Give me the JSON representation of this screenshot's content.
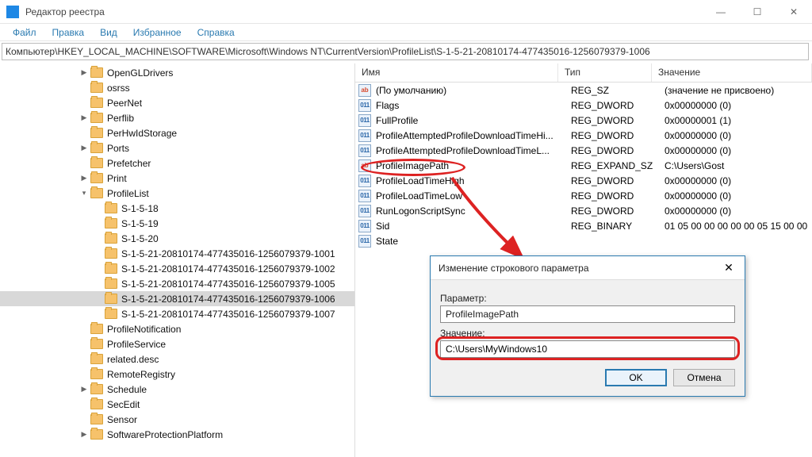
{
  "titlebar": {
    "title": "Редактор реестра"
  },
  "menu": {
    "file": "Файл",
    "edit": "Правка",
    "view": "Вид",
    "favorites": "Избранное",
    "help": "Справка"
  },
  "address": "Компьютер\\HKEY_LOCAL_MACHINE\\SOFTWARE\\Microsoft\\Windows NT\\CurrentVersion\\ProfileList\\S-1-5-21-20810174-477435016-1256079379-1006",
  "tree": [
    {
      "indent": 5,
      "tw": "▶",
      "label": "OpenGLDrivers"
    },
    {
      "indent": 5,
      "tw": "",
      "label": "osrss"
    },
    {
      "indent": 5,
      "tw": "",
      "label": "PeerNet"
    },
    {
      "indent": 5,
      "tw": "▶",
      "label": "Perflib"
    },
    {
      "indent": 5,
      "tw": "",
      "label": "PerHwIdStorage"
    },
    {
      "indent": 5,
      "tw": "▶",
      "label": "Ports"
    },
    {
      "indent": 5,
      "tw": "",
      "label": "Prefetcher"
    },
    {
      "indent": 5,
      "tw": "▶",
      "label": "Print"
    },
    {
      "indent": 5,
      "tw": "▾",
      "label": "ProfileList"
    },
    {
      "indent": 6,
      "tw": "",
      "label": "S-1-5-18"
    },
    {
      "indent": 6,
      "tw": "",
      "label": "S-1-5-19"
    },
    {
      "indent": 6,
      "tw": "",
      "label": "S-1-5-20"
    },
    {
      "indent": 6,
      "tw": "",
      "label": "S-1-5-21-20810174-477435016-1256079379-1001"
    },
    {
      "indent": 6,
      "tw": "",
      "label": "S-1-5-21-20810174-477435016-1256079379-1002"
    },
    {
      "indent": 6,
      "tw": "",
      "label": "S-1-5-21-20810174-477435016-1256079379-1005"
    },
    {
      "indent": 6,
      "tw": "",
      "label": "S-1-5-21-20810174-477435016-1256079379-1006",
      "selected": true
    },
    {
      "indent": 6,
      "tw": "",
      "label": "S-1-5-21-20810174-477435016-1256079379-1007"
    },
    {
      "indent": 5,
      "tw": "",
      "label": "ProfileNotification"
    },
    {
      "indent": 5,
      "tw": "",
      "label": "ProfileService"
    },
    {
      "indent": 5,
      "tw": "",
      "label": "related.desc"
    },
    {
      "indent": 5,
      "tw": "",
      "label": "RemoteRegistry"
    },
    {
      "indent": 5,
      "tw": "▶",
      "label": "Schedule"
    },
    {
      "indent": 5,
      "tw": "",
      "label": "SecEdit"
    },
    {
      "indent": 5,
      "tw": "",
      "label": "Sensor"
    },
    {
      "indent": 5,
      "tw": "▶",
      "label": "SoftwareProtectionPlatform"
    }
  ],
  "list": {
    "headers": {
      "name": "Имя",
      "type": "Тип",
      "value": "Значение"
    },
    "rows": [
      {
        "icon": "ab",
        "name": "(По умолчанию)",
        "type": "REG_SZ",
        "value": "(значение не присвоено)"
      },
      {
        "icon": "bin",
        "name": "Flags",
        "type": "REG_DWORD",
        "value": "0x00000000 (0)"
      },
      {
        "icon": "bin",
        "name": "FullProfile",
        "type": "REG_DWORD",
        "value": "0x00000001 (1)"
      },
      {
        "icon": "bin",
        "name": "ProfileAttemptedProfileDownloadTimeHi...",
        "type": "REG_DWORD",
        "value": "0x00000000 (0)"
      },
      {
        "icon": "bin",
        "name": "ProfileAttemptedProfileDownloadTimeL...",
        "type": "REG_DWORD",
        "value": "0x00000000 (0)"
      },
      {
        "icon": "ab",
        "name": "ProfileImagePath",
        "type": "REG_EXPAND_SZ",
        "value": "C:\\Users\\Gost"
      },
      {
        "icon": "bin",
        "name": "ProfileLoadTimeHigh",
        "type": "REG_DWORD",
        "value": "0x00000000 (0)"
      },
      {
        "icon": "bin",
        "name": "ProfileLoadTimeLow",
        "type": "REG_DWORD",
        "value": "0x00000000 (0)"
      },
      {
        "icon": "bin",
        "name": "RunLogonScriptSync",
        "type": "REG_DWORD",
        "value": "0x00000000 (0)"
      },
      {
        "icon": "bin",
        "name": "Sid",
        "type": "REG_BINARY",
        "value": "01 05 00 00 00 00 00 05 15 00 00"
      },
      {
        "icon": "bin",
        "name": "State",
        "type": "",
        "value": ""
      }
    ]
  },
  "dialog": {
    "title": "Изменение строкового параметра",
    "param_label": "Параметр:",
    "param_value": "ProfileImagePath",
    "value_label": "Значение:",
    "value_value": "C:\\Users\\MyWindows10",
    "ok": "OK",
    "cancel": "Отмена"
  }
}
